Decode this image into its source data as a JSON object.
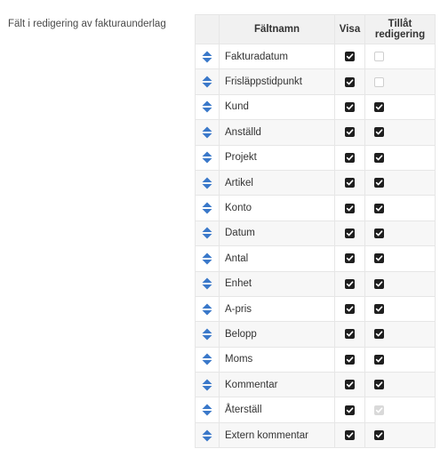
{
  "section_label": "Fält i redigering av fakturaunderlag",
  "columns": {
    "handle": "",
    "name": "Fältnamn",
    "visa": "Visa",
    "edit": "Tillåt redigering"
  },
  "icons": {
    "sort": "sort-up-down-icon",
    "checkbox_checked": "checkbox-checked-icon",
    "checkbox_unchecked": "checkbox-unchecked-icon"
  },
  "colors": {
    "sort_icon": "#3a78c9",
    "checkbox_checked": "#1f1f1f",
    "checkbox_disabled": "#d9d9d9",
    "header_bg": "#f1f1f1"
  },
  "rows": [
    {
      "name": "Fakturadatum",
      "visa": true,
      "edit": false,
      "edit_disabled": true
    },
    {
      "name": "Frisläppstidpunkt",
      "visa": true,
      "edit": false,
      "edit_disabled": true
    },
    {
      "name": "Kund",
      "visa": true,
      "edit": true,
      "edit_disabled": false
    },
    {
      "name": "Anställd",
      "visa": true,
      "edit": true,
      "edit_disabled": false
    },
    {
      "name": "Projekt",
      "visa": true,
      "edit": true,
      "edit_disabled": false
    },
    {
      "name": "Artikel",
      "visa": true,
      "edit": true,
      "edit_disabled": false
    },
    {
      "name": "Konto",
      "visa": true,
      "edit": true,
      "edit_disabled": false
    },
    {
      "name": "Datum",
      "visa": true,
      "edit": true,
      "edit_disabled": false
    },
    {
      "name": "Antal",
      "visa": true,
      "edit": true,
      "edit_disabled": false
    },
    {
      "name": "Enhet",
      "visa": true,
      "edit": true,
      "edit_disabled": false
    },
    {
      "name": "A-pris",
      "visa": true,
      "edit": true,
      "edit_disabled": false
    },
    {
      "name": "Belopp",
      "visa": true,
      "edit": true,
      "edit_disabled": false
    },
    {
      "name": "Moms",
      "visa": true,
      "edit": true,
      "edit_disabled": false
    },
    {
      "name": "Kommentar",
      "visa": true,
      "edit": true,
      "edit_disabled": false
    },
    {
      "name": "Återställ",
      "visa": true,
      "edit": true,
      "edit_disabled": true
    },
    {
      "name": "Extern kommentar",
      "visa": true,
      "edit": true,
      "edit_disabled": false
    }
  ]
}
